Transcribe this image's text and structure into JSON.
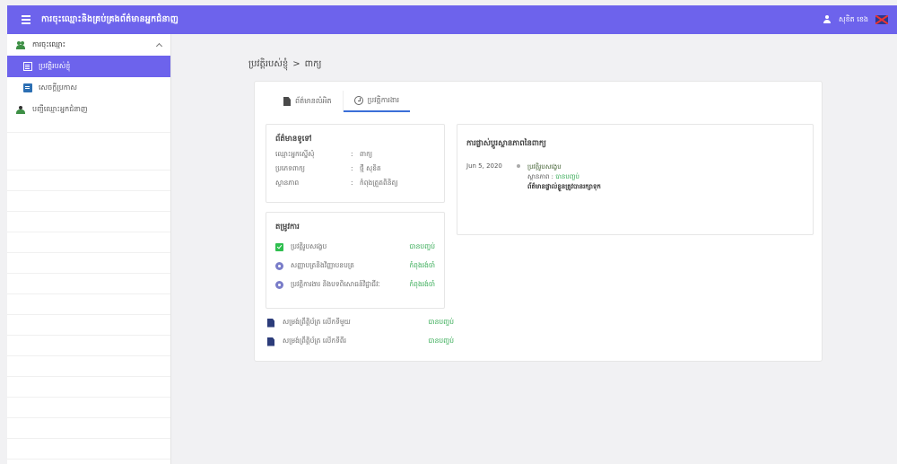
{
  "header": {
    "title": "ការចុះឈ្មោះនិងគ្រប់គ្រងព័ត៌មានអ្នកជំនាញ",
    "user_name": "សុខិត ខេង",
    "accent_color": "#6d63ec"
  },
  "sidebar": {
    "group_label": "ការចុះឈ្មោះ",
    "items": [
      {
        "label": "ប្រវត្តិរបស់ខ្ញុំ",
        "icon": "list-icon",
        "active": true
      },
      {
        "label": "សេចក្តីប្រកាស",
        "icon": "document-icon",
        "active": false
      },
      {
        "label": "បញ្ជីឈ្មោះអ្នកជំនាញ",
        "icon": "group-icon",
        "active": false
      }
    ]
  },
  "breadcrumb": {
    "parent": "ប្រវត្តិរបស់ខ្ញុំ",
    "separator": ">",
    "current": "ពាក្យ"
  },
  "tabs": [
    {
      "label": "ព័ត៌មានលំអិត",
      "icon": "file-icon",
      "active": false
    },
    {
      "label": "ប្រវត្តិការងារ",
      "icon": "clock-icon",
      "active": true
    }
  ],
  "info": {
    "title": "ព័ត៌មានទូទៅ",
    "rows": [
      {
        "label": "ឈ្មោះអ្នកស្នើសុំ",
        "value": "ពាក្យ"
      },
      {
        "label": "ប្រភេទពាក្យ",
        "value": "ថ្មី សុខិត"
      },
      {
        "label": "ស្ថានភាព",
        "value": "កំពុងត្រួតពិនិត្យ"
      }
    ]
  },
  "requirements": {
    "title": "តម្រូវការ",
    "rows": [
      {
        "label": "ប្រវត្តិរូបសង្ខេប",
        "status": "បានបញ្ចប់",
        "icon": "check-icon"
      },
      {
        "label": "សញ្ញាបត្រនិងវិញ្ញាបនបត្រ",
        "status": "កំពុងរង់ចាំ",
        "icon": "radio-icon"
      },
      {
        "label": "ប្រវត្តិការងារ និងបទពិសោធន៍វិជ្ជាជីវៈ",
        "status": "កំពុងរង់ចាំ",
        "icon": "radio-icon"
      }
    ]
  },
  "files": [
    {
      "label": "សម្រង់ព្រឹត្តិប័ត្រ លើកទីមួយ",
      "status": "បានបញ្ចប់"
    },
    {
      "label": "សម្រង់ព្រឹត្តិប័ត្រ លើកទីពីរ",
      "status": "បានបញ្ចប់"
    }
  ],
  "status_history": {
    "title": "ការផ្លាស់ប្តូរស្ថានភាពនៃពាក្យ",
    "entries": [
      {
        "date": "Jun 5, 2020",
        "line1": "ប្រវត្តិរូបសង្ខេប",
        "line2_label": "ស្ថានភាព :",
        "line2_value": "បានបញ្ចប់",
        "line3": "ព័ត៌មានផ្ទាល់ខ្លួនត្រូវបានរក្សាទុក"
      }
    ]
  }
}
